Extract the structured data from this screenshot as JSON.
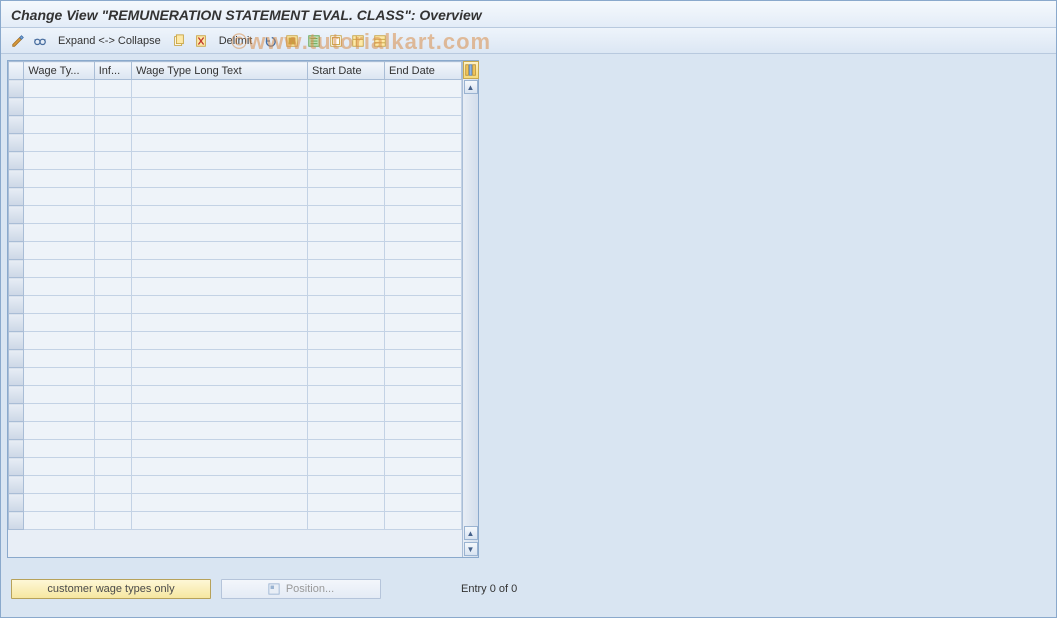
{
  "title": "Change View \"REMUNERATION STATEMENT EVAL. CLASS\": Overview",
  "toolbar": {
    "expand_collapse": "Expand <-> Collapse",
    "delimit": "Delimit"
  },
  "grid": {
    "columns": [
      "Wage Ty...",
      "Inf...",
      "Wage Type Long Text",
      "Start Date",
      "End Date"
    ],
    "row_count": 25
  },
  "buttons": {
    "customer": "customer wage types only",
    "position": "Position..."
  },
  "status": {
    "entry": "Entry 0 of 0"
  },
  "watermark": "©www.tutorialkart.com"
}
